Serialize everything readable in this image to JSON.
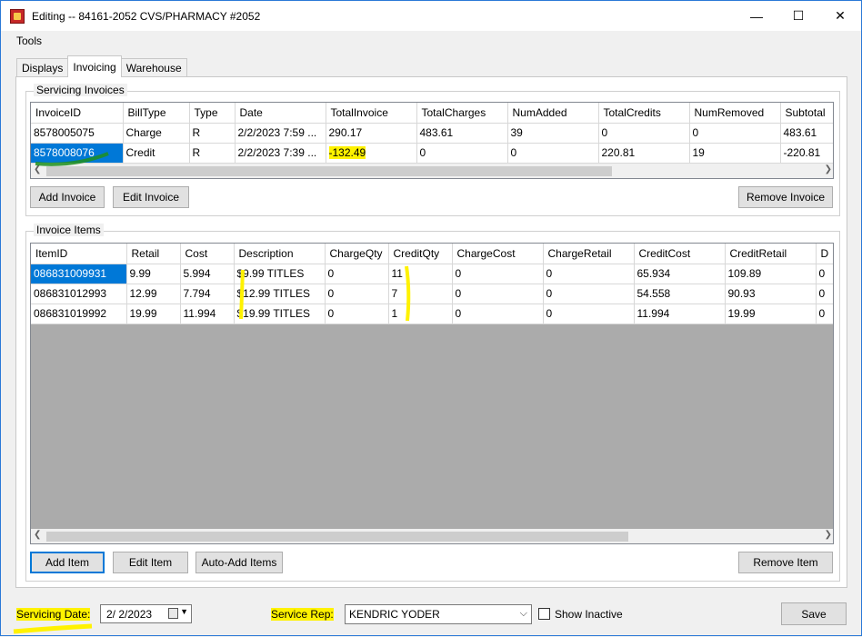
{
  "window": {
    "title": "Editing -- 84161-2052 CVS/PHARMACY #2052",
    "minimize": "—",
    "maximize": "☐",
    "close": "✕"
  },
  "menu": [
    "Tools"
  ],
  "tabs": [
    {
      "label": "Displays",
      "active": false
    },
    {
      "label": "Invoicing",
      "active": true
    },
    {
      "label": "Warehouse",
      "active": false
    }
  ],
  "servicing_invoices": {
    "title": "Servicing Invoices",
    "columns": [
      "InvoiceID",
      "BillType",
      "Type",
      "Date",
      "TotalInvoice",
      "TotalCharges",
      "NumAdded",
      "TotalCredits",
      "NumRemoved",
      "Subtotal"
    ],
    "rows": [
      [
        "8578005075",
        "Charge",
        "R",
        "2/2/2023 7:59 ...",
        "290.17",
        "483.61",
        "39",
        "0",
        "0",
        "483.61"
      ],
      [
        "8578008076",
        "Credit",
        "R",
        "2/2/2023 7:39 ...",
        "-132.49",
        "0",
        "0",
        "220.81",
        "19",
        "-220.81"
      ]
    ],
    "buttons": {
      "add": "Add Invoice",
      "edit": "Edit Invoice",
      "remove": "Remove Invoice"
    }
  },
  "invoice_items": {
    "title": "Invoice Items",
    "columns": [
      "ItemID",
      "Retail",
      "Cost",
      "Description",
      "ChargeQty",
      "CreditQty",
      "ChargeCost",
      "ChargeRetail",
      "CreditCost",
      "CreditRetail",
      "D"
    ],
    "rows": [
      [
        "086831009931",
        "9.99",
        "5.994",
        "$9.99 TITLES",
        "0",
        "11",
        "0",
        "0",
        "65.934",
        "109.89",
        "0"
      ],
      [
        "086831012993",
        "12.99",
        "7.794",
        "$12.99 TITLES",
        "0",
        "7",
        "0",
        "0",
        "54.558",
        "90.93",
        "0"
      ],
      [
        "086831019992",
        "19.99",
        "11.994",
        "$19.99 TITLES",
        "0",
        "1",
        "0",
        "0",
        "11.994",
        "19.99",
        "0"
      ]
    ],
    "buttons": {
      "add": "Add Item",
      "edit": "Edit Item",
      "auto_add": "Auto-Add Items",
      "remove": "Remove Item"
    }
  },
  "footer": {
    "servicing_date_label": "Servicing Date:",
    "servicing_date_value": "2/  2/2023",
    "service_rep_label": "Service Rep:",
    "service_rep_value": "KENDRIC YODER",
    "show_inactive_label": "Show Inactive",
    "save_label": "Save"
  },
  "colors": {
    "selection": "#0078d7",
    "highlighter_yellow": "#fff200",
    "marker_green": "#1f8f1f"
  }
}
